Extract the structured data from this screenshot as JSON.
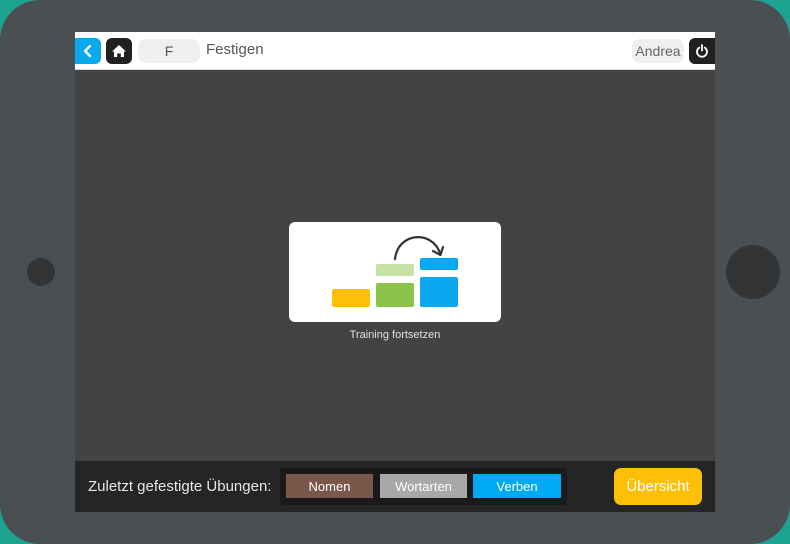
{
  "topbar": {
    "letter": "F",
    "topic": "Festigen",
    "user": "Andrea",
    "back_icon": "chevron-left-icon",
    "home_icon": "home-icon",
    "power_icon": "power-icon"
  },
  "main": {
    "card_caption": "Training fortsetzen",
    "card_icon": "continue-training-icon"
  },
  "bottombar": {
    "recent_label": "Zuletzt gefestigte Übungen:",
    "chips": [
      {
        "label": "Nomen",
        "color": "#7a574b"
      },
      {
        "label": "Wortarten",
        "color": "#a8a8a8"
      },
      {
        "label": "Verben",
        "color": "#00aaf2"
      }
    ],
    "overview_label": "Übersicht"
  },
  "colors": {
    "accent_blue": "#0aa8ee",
    "accent_yellow": "#fec007",
    "accent_green": "#8bc34a",
    "light_green": "#c5e1a5"
  }
}
